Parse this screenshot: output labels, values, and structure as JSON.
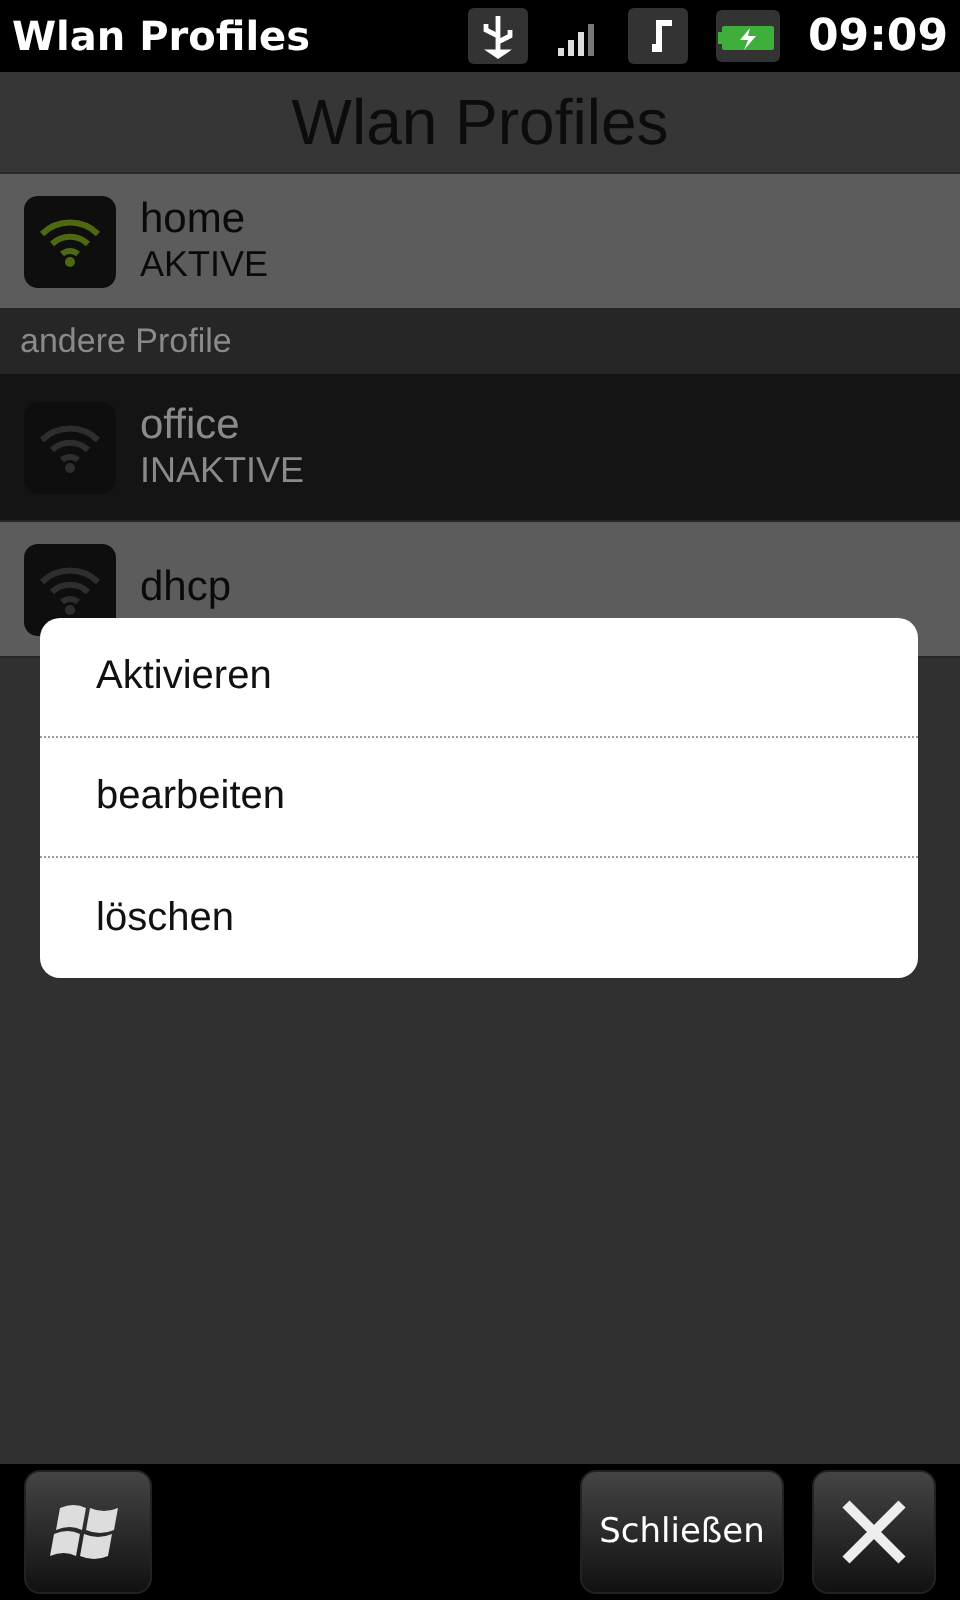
{
  "status_bar": {
    "title": "Wlan Profiles",
    "time": "09:09"
  },
  "header": {
    "title": "Wlan Profiles"
  },
  "active_profiles": [
    {
      "name": "home",
      "status": "AKTIVE",
      "active": true,
      "selected": false
    }
  ],
  "section": {
    "title": "andere Profile"
  },
  "other_profiles": [
    {
      "name": "office",
      "status": "INAKTIVE",
      "active": false,
      "selected": true
    },
    {
      "name": "dhcp",
      "active": false,
      "selected": false
    }
  ],
  "menu": {
    "items": [
      "Aktivieren",
      "bearbeiten",
      "löschen"
    ]
  },
  "bottom_bar": {
    "close_label": "Schließen"
  }
}
